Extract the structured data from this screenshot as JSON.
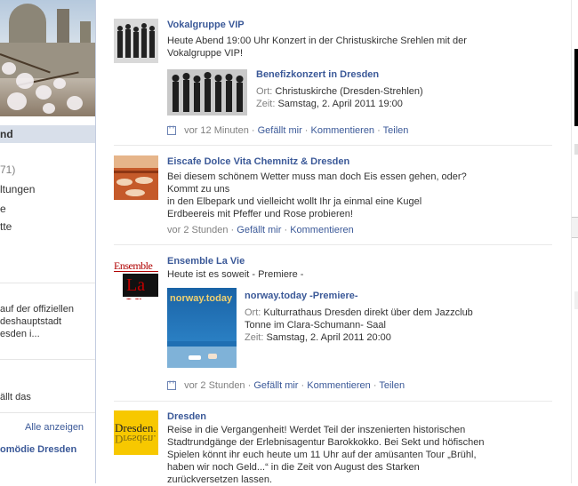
{
  "sidebar": {
    "active_item": "nd",
    "count_item": "71)",
    "items": [
      "ltungen",
      "e",
      "tte"
    ],
    "promo_lines": [
      "auf der offiziellen",
      "deshauptstadt",
      "esden i..."
    ],
    "likes_text": "ällt das",
    "show_all": "Alle anzeigen",
    "liked_page": "omödie Dresden"
  },
  "posts": [
    {
      "name": "Vokalgruppe VIP",
      "text": "Heute Abend 19:00 Uhr Konzert in der Christuskirche Srehlen mit der\nVokalgruppe VIP!",
      "attachment": {
        "title": "Benefizkonzert in Dresden",
        "lines": [
          {
            "label": "Ort:",
            "value": "Christuskirche (Dresden-Strehlen)"
          },
          {
            "label": "Zeit:",
            "value": "Samstag, 2. April 2011 19:00"
          }
        ]
      },
      "meta": {
        "time": "vor 12 Minuten",
        "actions": [
          "Gefällt mir",
          "Kommentieren",
          "Teilen"
        ]
      }
    },
    {
      "name": "Eiscafe Dolce Vita Chemnitz & Dresden",
      "text": "Bei diesem schönem Wetter muss man doch Eis essen gehen, oder?\nKommt zu uns\nin den Elbepark und vielleicht wollt Ihr ja einmal eine Kugel\nErdbeereis mit Pfeffer und Rose probieren!",
      "meta": {
        "time": "vor 2 Stunden",
        "actions": [
          "Gefällt mir",
          "Kommentieren"
        ]
      }
    },
    {
      "name": "Ensemble La Vie",
      "text": "Heute ist es soweit - Premiere -",
      "thumb_text": [
        "Ensemble",
        "La Vi"
      ],
      "attachment": {
        "title": "norway.today -Premiere-",
        "image_text": "norway.today",
        "lines": [
          {
            "label": "Ort:",
            "value": "Kulturrathaus Dresden direkt über dem Jazzclub"
          },
          {
            "label": "",
            "value": "Tonne im Clara-Schumann- Saal"
          },
          {
            "label": "Zeit:",
            "value": "Samstag, 2. April 2011 20:00"
          }
        ]
      },
      "meta": {
        "time": "vor 2 Stunden",
        "actions": [
          "Gefällt mir",
          "Kommentieren",
          "Teilen"
        ]
      }
    },
    {
      "name": "Dresden",
      "thumb_text": [
        "Dresden.",
        "Dresden."
      ],
      "text": "Reise in die Vergangenheit! Werdet Teil der inszenierten historischen\nStadtrundgänge der Erlebnisagentur Barokkokko. Bei Sekt und höfischen\nSpielen könnt ihr euch heute um 11 Uhr auf der amüsanten Tour „Brühl,\nhaben wir noch Geld...“ in die Zeit von August des Starken\nzurückversetzen lassen."
    }
  ],
  "colors": {
    "link": "#3b5998",
    "meta": "#808080",
    "active_bg": "#d8dfea",
    "dresden_yellow": "#f7c800"
  }
}
